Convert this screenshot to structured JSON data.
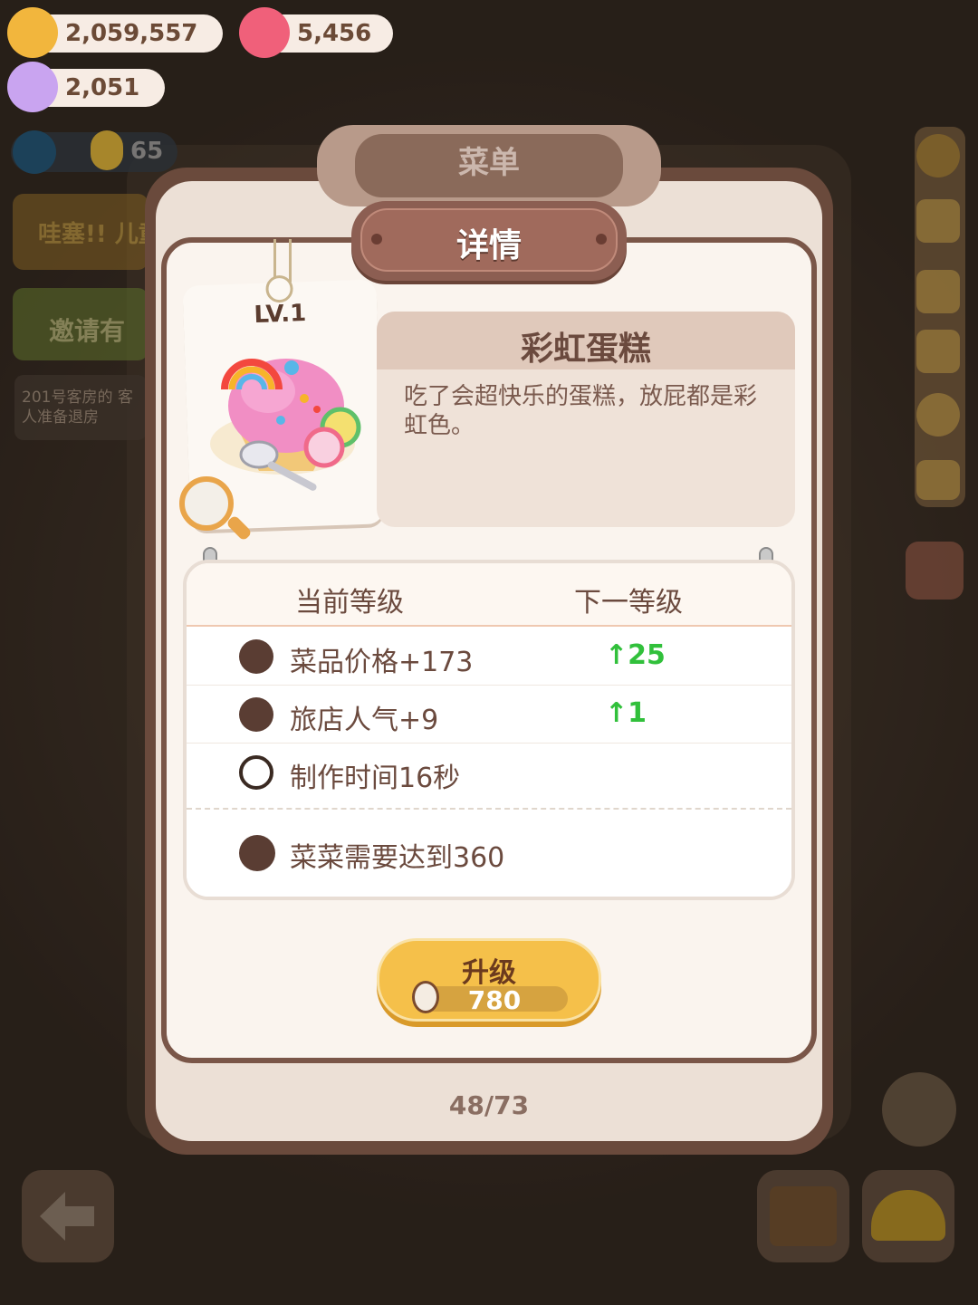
{
  "currencies": {
    "coins": "2,059,557",
    "jelly": "5,456",
    "candy": "2,051"
  },
  "status_counter": "65",
  "event_banners": [
    "哇塞!! 儿童节",
    "邀请有"
  ],
  "notice": "201号客房的 客人准备退房",
  "tabs": {
    "menu": "菜单",
    "detail": "详情"
  },
  "item": {
    "level": "LV.1",
    "name": "彩虹蛋糕",
    "description": "吃了会超快乐的蛋糕，放屁都是彩虹色。"
  },
  "stats_header": {
    "current": "当前等级",
    "next": "下一等级"
  },
  "stats": [
    {
      "label": "菜品价格+173",
      "next": "↑25",
      "icon": "cookie-icon"
    },
    {
      "label": "旅店人气+9",
      "next": "↑1",
      "icon": "cupcake-icon"
    },
    {
      "label": "制作时间16秒",
      "next": "",
      "icon": "alarm-clock-icon"
    }
  ],
  "requirement": "菜菜需要达到360",
  "upgrade": {
    "label": "升级",
    "cost": "780"
  },
  "pagination": "48/73",
  "colors": {
    "accent_green": "#31c03b",
    "panel_brown": "#7a5648",
    "button_yellow": "#f5c04a"
  }
}
